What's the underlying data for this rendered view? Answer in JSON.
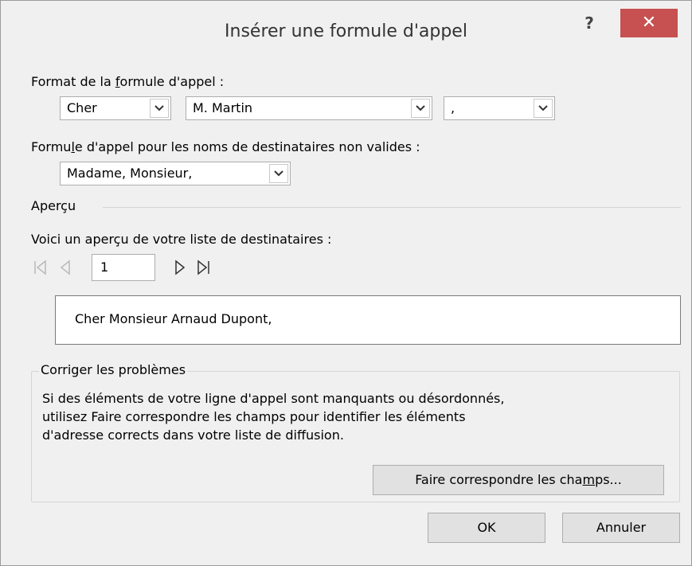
{
  "window": {
    "title": "Insérer une formule d'appel",
    "help_label": "?",
    "close_label": "✕"
  },
  "salutation_format": {
    "label_before": "Format de la ",
    "label_accel": "f",
    "label_after": "ormule d'appel :",
    "greeting": "Cher",
    "name_format": "M. Martin",
    "punctuation": ","
  },
  "invalid_names": {
    "label_before": "Formu",
    "label_accel": "l",
    "label_after": "e d'appel pour les noms de destinataires non valides :",
    "value": "Madame, Monsieur,"
  },
  "preview": {
    "section_label": "Aperçu",
    "description": "Voici un aperçu de votre liste de destinataires :",
    "page_number": "1",
    "text": "Cher Monsieur Arnaud Dupont,"
  },
  "fix": {
    "legend": "Corriger les problèmes",
    "line1": "Si des éléments de votre ligne d'appel sont manquants ou désordonnés,",
    "line2": "utilisez Faire correspondre les champs pour identifier les éléments",
    "line3": "d'adresse corrects dans votre liste de diffusion.",
    "match_button_before": "Faire correspondre les cha",
    "match_button_accel": "m",
    "match_button_after": "ps..."
  },
  "buttons": {
    "ok": "OK",
    "cancel": "Annuler"
  },
  "colors": {
    "close_button": "#c75050",
    "background": "#f0f0f0"
  }
}
